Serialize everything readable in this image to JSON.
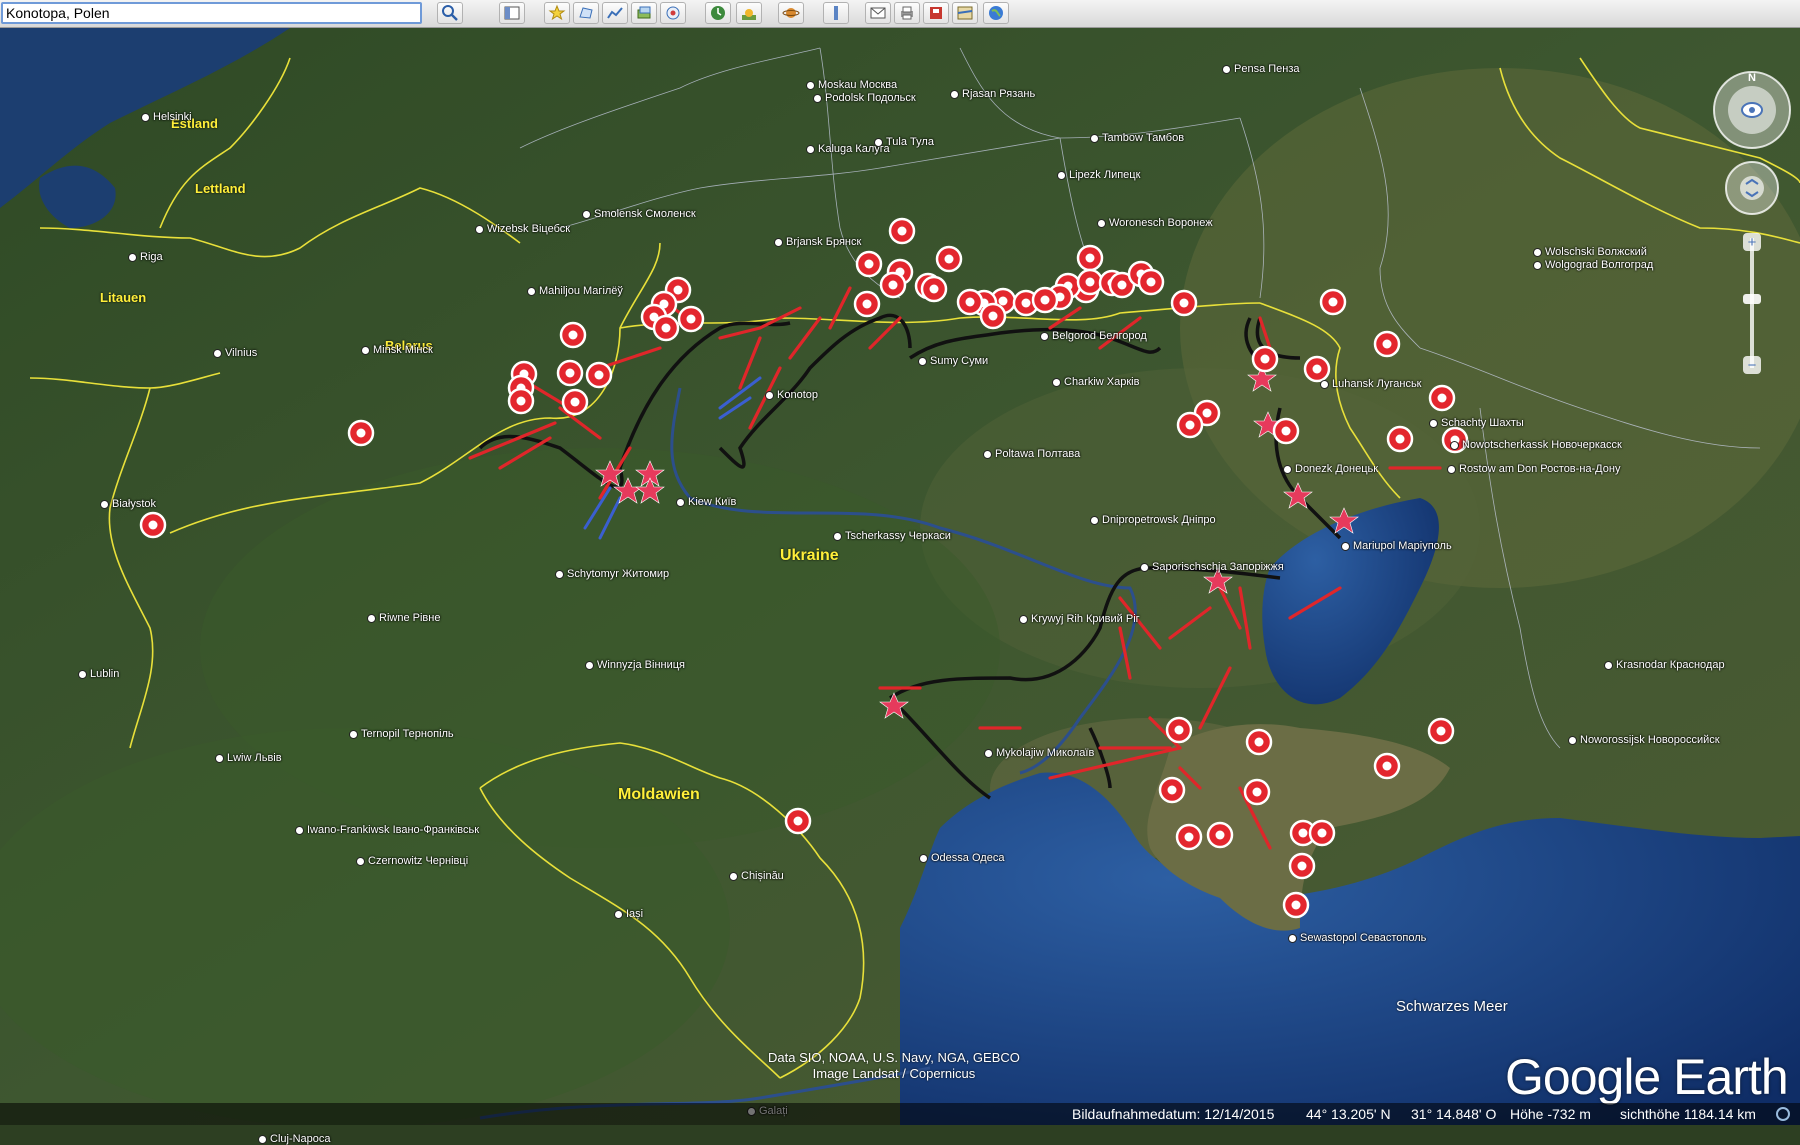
{
  "search": {
    "value": "Konotopa, Polen"
  },
  "toolbar": {
    "buttons": [
      "search-icon",
      "sidebar-icon",
      "placemark-icon",
      "polygon-icon",
      "path-icon",
      "overlay-icon",
      "tour-icon",
      "history-icon",
      "sunlight-icon",
      "planet-icon",
      "ruler-icon",
      "email-icon",
      "print-icon",
      "save-image-icon",
      "maps-icon",
      "earth-view-icon"
    ]
  },
  "map": {
    "countries": {
      "estland": "Estland",
      "lettland": "Lettland",
      "litauen": "Litauen",
      "belarus": "Belarus",
      "ukraine": "Ukraine",
      "moldawien": "Moldawien"
    },
    "sea": "Schwarzes Meer",
    "cities": [
      {
        "name": "Helsinki"
      },
      {
        "name": "Riga"
      },
      {
        "name": "Vilnius"
      },
      {
        "name": "Minsk Мінск"
      },
      {
        "name": "Wizebsk Віцебск"
      },
      {
        "name": "Mahiljou Магілёў"
      },
      {
        "name": "Smolensk Смоленск"
      },
      {
        "name": "Moskau Москва"
      },
      {
        "name": "Podolsk Подольск"
      },
      {
        "name": "Rjasan Рязань"
      },
      {
        "name": "Pensa Пенза"
      },
      {
        "name": "Kaluga Калуга"
      },
      {
        "name": "Tula Тула"
      },
      {
        "name": "Tambow Тамбов"
      },
      {
        "name": "Lipezk Липецк"
      },
      {
        "name": "Woronesch Воронеж"
      },
      {
        "name": "Brjansk Брянск"
      },
      {
        "name": "Belgorod Белгород"
      },
      {
        "name": "Sumy Суми"
      },
      {
        "name": "Charkiw Харків"
      },
      {
        "name": "Konotop"
      },
      {
        "name": "Poltawa Полтава"
      },
      {
        "name": "Kiew Київ"
      },
      {
        "name": "Tscherkassy Черкаси"
      },
      {
        "name": "Dnipropetrowsk Дніпро"
      },
      {
        "name": "Saporischschja Запоріжжя"
      },
      {
        "name": "Krywyj Rih Кривий Ріг"
      },
      {
        "name": "Mykolajiw Миколаїв"
      },
      {
        "name": "Odessa Одеса"
      },
      {
        "name": "Schytomyr Житомир"
      },
      {
        "name": "Riwne Рівне"
      },
      {
        "name": "Winnyzja Вінниця"
      },
      {
        "name": "Ternopil Тернопіль"
      },
      {
        "name": "Lwiw Львів"
      },
      {
        "name": "Iwano-Frankiwsk Івано-Франківськ"
      },
      {
        "name": "Czernowitz Чернівці"
      },
      {
        "name": "Chișinău"
      },
      {
        "name": "Iași"
      },
      {
        "name": "Galați"
      },
      {
        "name": "Cluj-Napoca"
      },
      {
        "name": "Białystok"
      },
      {
        "name": "Lublin"
      },
      {
        "name": "Luhansk Луганськ"
      },
      {
        "name": "Donezk Донецьк"
      },
      {
        "name": "Mariupol Маріуполь"
      },
      {
        "name": "Schachty Шахты"
      },
      {
        "name": "Nowotscherkassk Новочеркасск"
      },
      {
        "name": "Rostow am Don Ростов-на-Дону"
      },
      {
        "name": "Wolschski Волжский"
      },
      {
        "name": "Wolgograd Волгоград"
      },
      {
        "name": "Krasnodar Краснодар"
      },
      {
        "name": "Noworossijsk Новороссийск"
      },
      {
        "name": "Sewastopol Севастополь"
      }
    ]
  },
  "attribution": {
    "line1": "Data SIO, NOAA, U.S. Navy, NGA, GEBCO",
    "line2": "Image Landsat / Copernicus"
  },
  "logo": "Google Earth",
  "status": {
    "date": "Bildaufnahmedatum: 12/14/2015",
    "lat": "44° 13.205' N",
    "lon": "31° 14.848' O",
    "elevation": "Höhe  -732 m",
    "eye_alt": "sichthöhe 1184.14 km"
  }
}
